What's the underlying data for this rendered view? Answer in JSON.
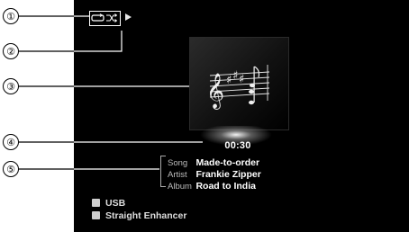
{
  "callouts": [
    "①",
    "②",
    "③",
    "④",
    "⑤"
  ],
  "status_icons": {
    "mode_box": "repeat-shuffle-icon",
    "play": "play-icon",
    "input": "input-icon",
    "dsp": "dsp-icon"
  },
  "playback": {
    "elapsed": "00:30"
  },
  "track": {
    "song_label": "Song",
    "song": "Made-to-order",
    "artist_label": "Artist",
    "artist": "Frankie Zipper",
    "album_label": "Album",
    "album": "Road to India"
  },
  "input": "USB",
  "dsp_program": "Straight Enhancer",
  "colors": {
    "screen_bg": "#000000",
    "text": "#ffffff",
    "label": "#bbbbbb"
  }
}
